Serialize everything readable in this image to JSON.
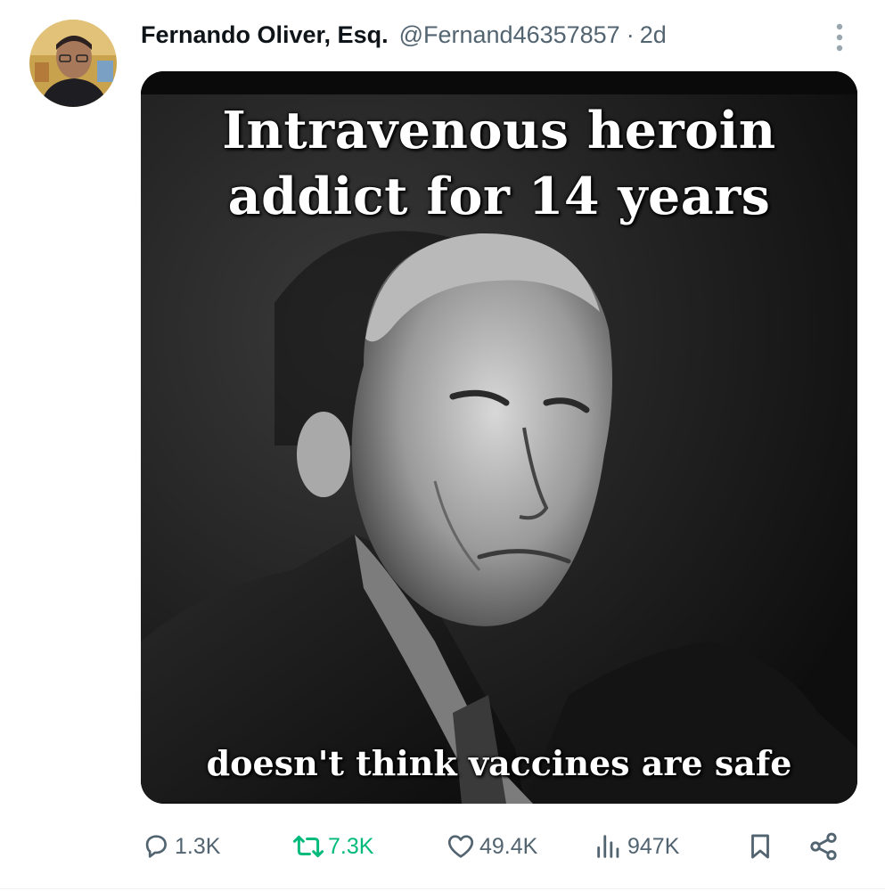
{
  "post": {
    "author": {
      "display_name": "Fernando Oliver, Esq.",
      "handle": "@Fernand46357857",
      "separator": "·",
      "time": "2d",
      "avatar_icon": "profile-photo"
    },
    "more_icon": "vertical-ellipsis-icon",
    "media": {
      "caption_top_line1": "Intravenous heroin",
      "caption_top_line2": "addict for 14 years",
      "caption_bottom": "doesn't think vaccines are safe"
    },
    "actions": {
      "replies": "1.3K",
      "reposts": "7.3K",
      "likes": "49.4K",
      "views": "947K"
    }
  },
  "colors": {
    "text_primary": "#0f1419",
    "text_secondary": "#536471",
    "repost_active": "#00ba7c",
    "divider": "#eff3f4"
  }
}
